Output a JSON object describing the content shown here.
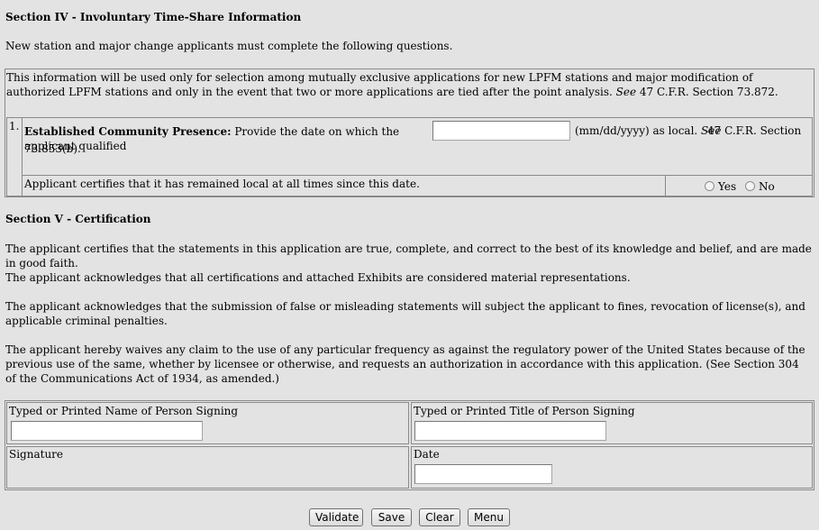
{
  "section4": {
    "heading": "Section IV - Involuntary Time-Share Information",
    "intro": "New station and major change applicants must complete the following questions.",
    "info_text_1": "This information will be used only for selection among mutually exclusive applications for new LPFM stations and major modification of authorized LPFM stations and only in the event that two or more applications are tied after the point analysis.",
    "info_see": "See",
    "info_text_2": " 47 C.F.R. Section 73.872.",
    "q1": {
      "number": "1.",
      "label_bold": "Established Community Presence:",
      "label_text": " Provide the date on which the applicant qualified",
      "date_value": "",
      "date_format": "(mm/dd/yyyy) as local.",
      "see": "See",
      "citation": " 47 C.F.R. Section 73.853(b).",
      "certify_text": "Applicant certifies that it has remained local at all times since this date.",
      "yes_label": "Yes",
      "no_label": "No"
    }
  },
  "section5": {
    "heading": "Section V - Certification",
    "paragraphs": [
      "The applicant certifies that the statements in this application are true, complete, and correct to the best of its knowledge and belief, and are made in good faith.",
      "The applicant acknowledges that all certifications and attached Exhibits are considered material representations.",
      "The applicant acknowledges that the submission of false or misleading statements will subject the applicant to fines, revocation of license(s), and applicable criminal penalties.",
      "The applicant hereby waives any claim to the use of any particular frequency as against the regulatory power of the United States because of the previous use of the same, whether by licensee or otherwise, and requests an authorization in accordance with this application. (See Section 304 of the Communications Act of 1934, as amended.)"
    ],
    "signer_name_label": "Typed or Printed Name of Person Signing",
    "signer_name_value": "",
    "signer_title_label": "Typed or Printed Title of Person Signing",
    "signer_title_value": "",
    "signature_label": "Signature",
    "date_label": "Date",
    "date_value": ""
  },
  "buttons": {
    "validate": "Validate",
    "save": "Save",
    "clear": "Clear",
    "menu": "Menu"
  }
}
